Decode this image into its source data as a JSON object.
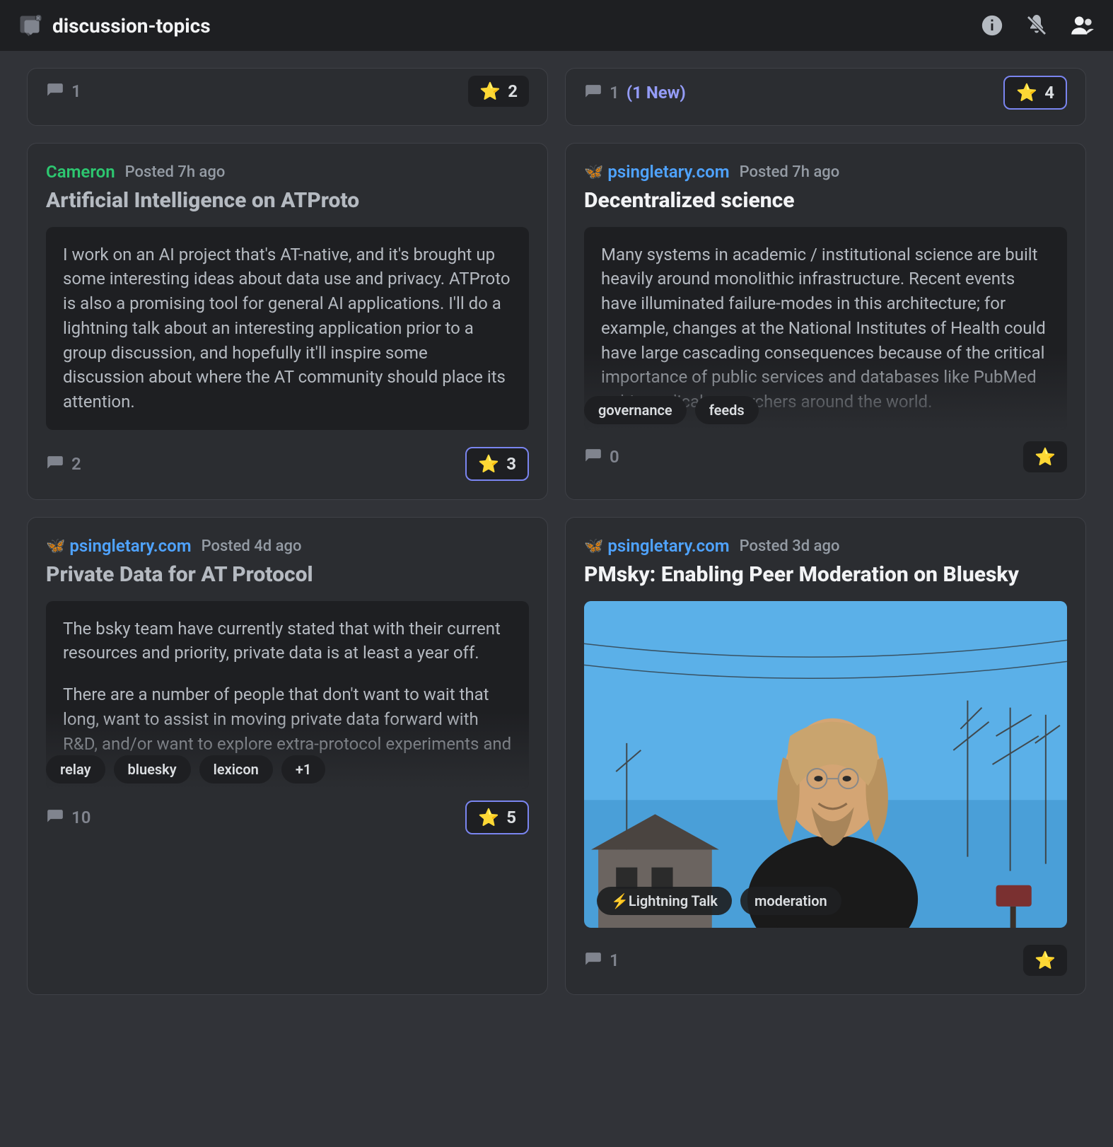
{
  "header": {
    "channel_name": "discussion-topics"
  },
  "partial": {
    "left": {
      "comments": "1",
      "stars": "2",
      "star_active": false
    },
    "right": {
      "comments": "1",
      "new_label": "(1 New)",
      "stars": "4",
      "star_active": true
    }
  },
  "cards": [
    {
      "author": "Cameron",
      "author_style": "green",
      "has_butterfly": false,
      "timestamp": "Posted 7h ago",
      "title": "Artificial Intelligence on ATProto",
      "title_muted": true,
      "excerpt": "I work on an AI project that's AT-native, and it's brought up some interesting ideas about data use and privacy. ATProto is also a promising tool for general AI applications. I'll do a lightning talk about an interesting application prior to a group discussion, and hopefully it'll inspire some discussion about where the AT community should place its attention.",
      "excerpt_fade": false,
      "tags": [],
      "comments": "2",
      "stars": "3",
      "star_active": true,
      "has_image": false
    },
    {
      "author": "psingletary.com",
      "author_style": "blue",
      "has_butterfly": true,
      "timestamp": "Posted 7h ago",
      "title": "Decentralized science",
      "title_muted": false,
      "excerpt": "Many systems in academic / institutional science are built heavily around monolithic infrastructure. Recent events have illuminated failure-modes in this architecture; for example, changes at the National Institutes of Health could have large cascading consequences because of the critical importance of public services and databases like PubMed to biomedical researchers around the world.",
      "excerpt_fade": true,
      "tags": [
        "governance",
        "feeds"
      ],
      "comments": "0",
      "stars": "",
      "star_active": false,
      "has_image": false
    },
    {
      "author": "psingletary.com",
      "author_style": "blue",
      "has_butterfly": true,
      "timestamp": "Posted 4d ago",
      "title": "Private Data for AT Protocol",
      "title_muted": true,
      "excerpt": "The bsky team have currently stated that with their current resources and priority, private data is at least a year off.\n\nThere are a number of people that don't want to wait that long, want to assist in moving private data forward with R&D, and/or want to explore extra-protocol experiments and",
      "excerpt_fade": true,
      "tags": [
        "relay",
        "bluesky",
        "lexicon",
        "+1"
      ],
      "comments": "10",
      "stars": "5",
      "star_active": true,
      "has_image": false
    },
    {
      "author": "psingletary.com",
      "author_style": "blue",
      "has_butterfly": true,
      "timestamp": "Posted 3d ago",
      "title": "PMsky: Enabling Peer Moderation on Bluesky",
      "title_muted": false,
      "excerpt": "",
      "excerpt_fade": false,
      "tags": [
        "⚡Lightning Talk",
        "moderation"
      ],
      "comments": "1",
      "stars": "",
      "star_active": false,
      "has_image": true
    }
  ]
}
